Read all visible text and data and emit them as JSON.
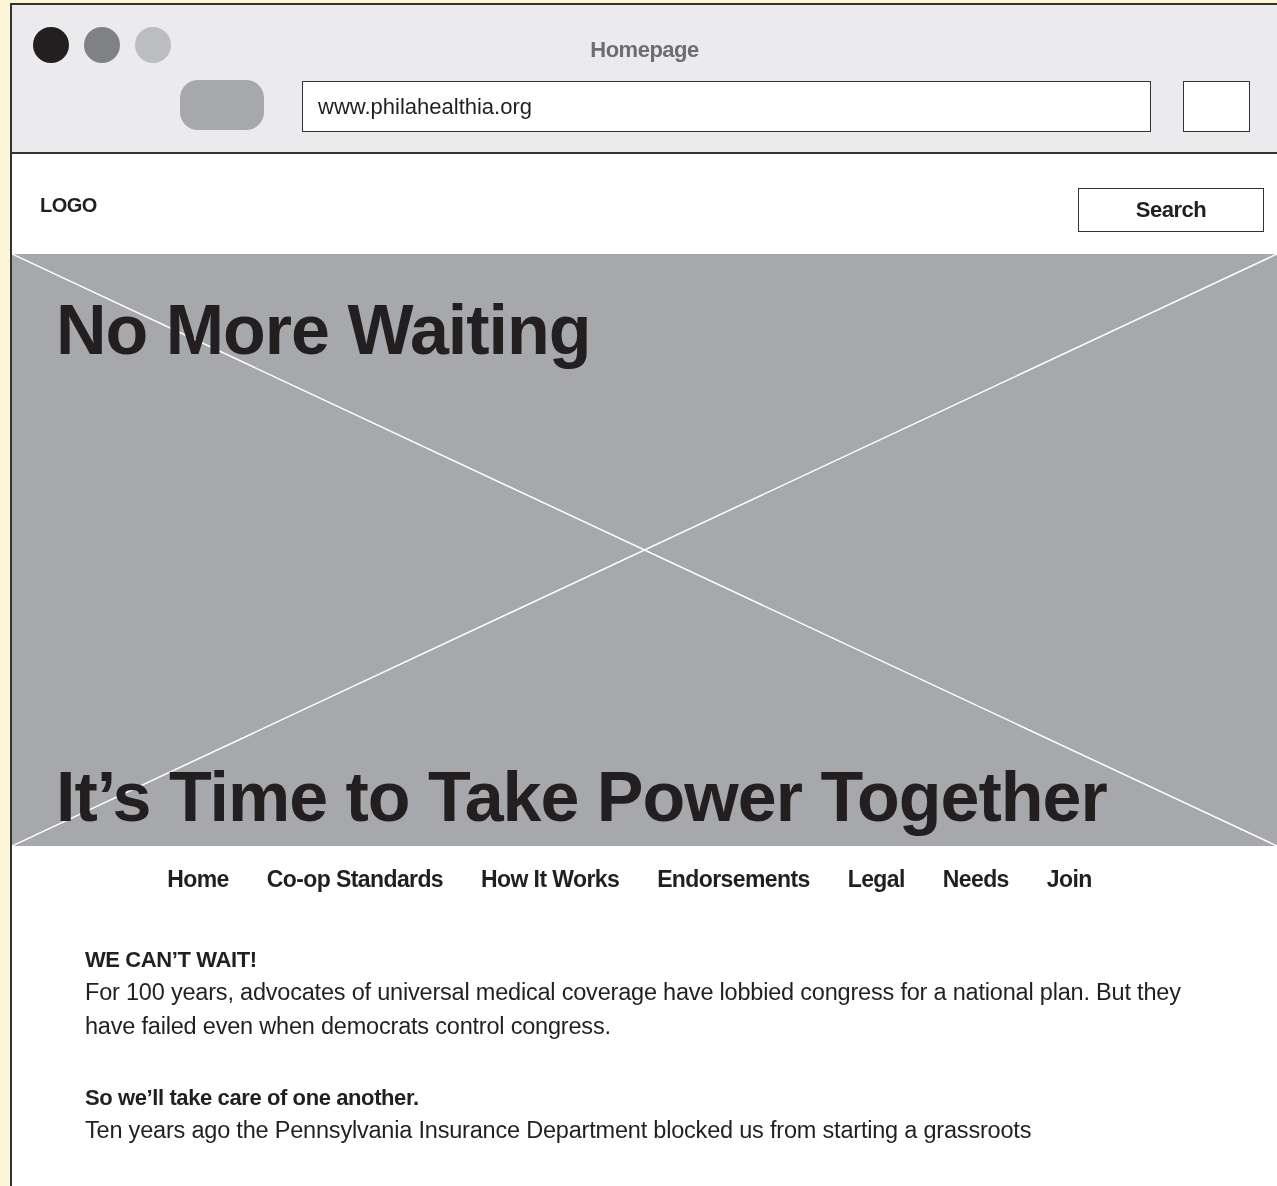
{
  "window": {
    "title": "Homepage",
    "address": "www.philahealthia.org"
  },
  "header": {
    "logo": "LOGO",
    "search_button": "Search"
  },
  "hero": {
    "headline": "No More Waiting",
    "tagline": "It’s Time to Take Power Together"
  },
  "nav": [
    "Home",
    "Co-op Standards",
    "How It Works",
    "Endorsements",
    "Legal",
    "Needs",
    "Join"
  ],
  "sections": [
    {
      "heading": "WE CAN’T WAIT!",
      "body": "For 100 years, advocates of universal medical coverage have lobbied congress for a national plan. But they have failed even when democrats control congress."
    },
    {
      "heading": "So we’ll take care of one another.",
      "body": "Ten years ago the Pennsylvania Insurance Department blocked us from starting a grassroots"
    }
  ]
}
